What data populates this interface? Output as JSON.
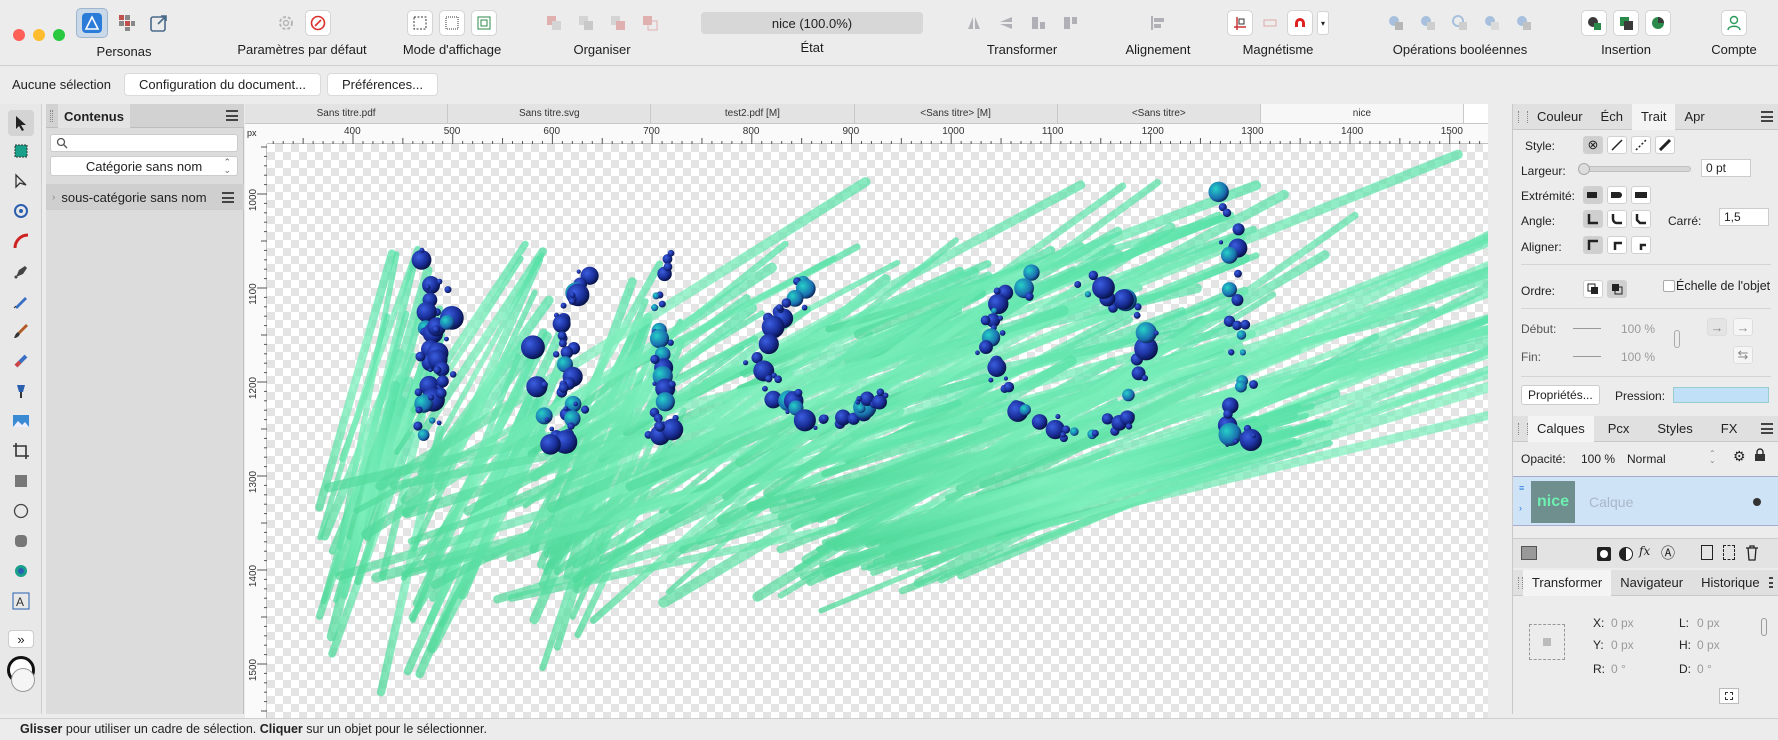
{
  "toolbar": {
    "personas_label": "Personas",
    "defaults_label": "Paramètres par défaut",
    "view_mode_label": "Mode d'affichage",
    "arrange_label": "Organiser",
    "state_value": "nice (100.0%)",
    "state_label": "État",
    "transform_label": "Transformer",
    "align_label": "Alignement",
    "snapping_label": "Magnétisme",
    "boolean_label": "Opérations booléennes",
    "insert_label": "Insertion",
    "account_label": "Compte"
  },
  "context_bar": {
    "selection_text": "Aucune sélection",
    "doc_setup_label": "Configuration du document...",
    "preferences_label": "Préférences..."
  },
  "contents_panel": {
    "title": "Contenus",
    "search_placeholder": "",
    "category_value": "Catégorie sans nom",
    "subcategory_label": "sous-catégorie sans nom"
  },
  "document_tabs": [
    {
      "label": "Sans titre.pdf"
    },
    {
      "label": "Sans titre.svg"
    },
    {
      "label": "test2.pdf [M]"
    },
    {
      "label": "<Sans titre> [M]"
    },
    {
      "label": "<Sans titre>"
    },
    {
      "label": "nice"
    }
  ],
  "ruler": {
    "unit": "px",
    "h_ticks": [
      "400",
      "500",
      "600",
      "700",
      "800",
      "900",
      "1000",
      "1100",
      "1200",
      "1300",
      "1400",
      "1500"
    ],
    "v_ticks": [
      "1000",
      "1100",
      "1200",
      "1300",
      "1400",
      "1500"
    ]
  },
  "canvas_art": {
    "text": "nice",
    "stroke_color": "#5ee8a8",
    "dot_color": "#1a2f9a"
  },
  "stroke_panel": {
    "tabs": [
      "Couleur",
      "Éch",
      "Trait",
      "Apr"
    ],
    "style_label": "Style:",
    "width_label": "Largeur:",
    "width_value": "0 pt",
    "cap_label": "Extrémité:",
    "join_label": "Angle:",
    "miter_label": "Carré:",
    "miter_value": "1,5",
    "align_label": "Aligner:",
    "order_label": "Ordre:",
    "scale_label": "Échelle de l'objet",
    "start_label": "Début:",
    "start_value": "100 %",
    "end_label": "Fin:",
    "end_value": "100 %",
    "properties_label": "Propriétés...",
    "pressure_label": "Pression:"
  },
  "layers_panel": {
    "tabs": [
      "Calques",
      "Pcx",
      "Styles",
      "FX"
    ],
    "opacity_label": "Opacité:",
    "opacity_value": "100 %",
    "blend_mode": "Normal",
    "layer_name": "Calque",
    "layer_thumb_text": "nice"
  },
  "transform_panel": {
    "tabs": [
      "Transformer",
      "Navigateur",
      "Historique"
    ],
    "x_label": "X:",
    "x_value": "0 px",
    "y_label": "Y:",
    "y_value": "0 px",
    "w_label": "L:",
    "w_value": "0 px",
    "h_label": "H:",
    "h_value": "0 px",
    "r_label": "R:",
    "r_value": "0 °",
    "s_label": "D:",
    "s_value": "0 °"
  },
  "status": {
    "drag_bold": "Glisser",
    "drag_text": " pour utiliser un cadre de sélection. ",
    "click_bold": "Cliquer",
    "click_text": " sur un objet pour le sélectionner."
  },
  "colors": {
    "accent": "#2c7be5",
    "selected_layer": "#cfe3f7",
    "stroke_green": "#5ee8a8"
  }
}
